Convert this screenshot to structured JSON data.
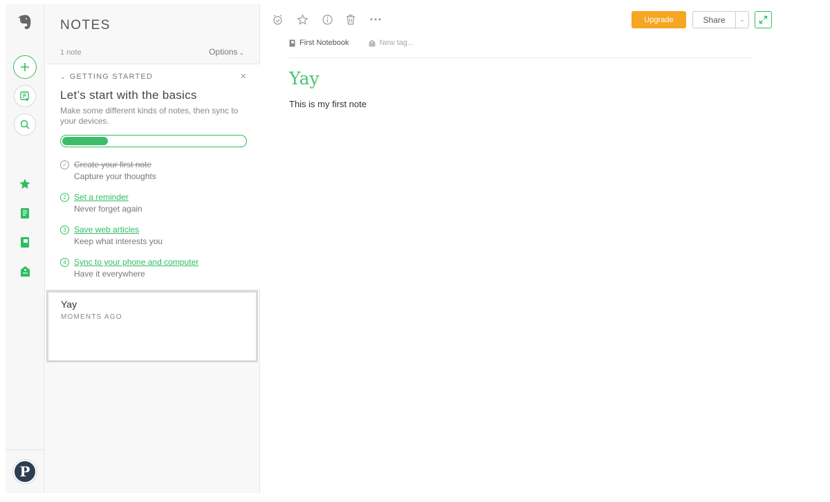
{
  "sidebar_rail": {
    "icons": [
      "elephant-logo",
      "new-note-icon",
      "work-chat-icon",
      "search-icon",
      "shortcuts-star-icon",
      "notes-icon",
      "notebooks-icon",
      "tags-icon"
    ],
    "avatar_letter": "P",
    "accent": "#2dbe60"
  },
  "notes_panel": {
    "title": "NOTES",
    "note_count": "1 note",
    "options_label": "Options"
  },
  "getting_started": {
    "header": "GETTING STARTED",
    "close": "×",
    "title": "Let’s start with the basics",
    "description": "Make some different kinds of notes, then sync to your devices.",
    "progress_fraction": 0.25,
    "steps": [
      {
        "num": "1",
        "label": "Create your first note",
        "sub": "Capture your thoughts",
        "done": true
      },
      {
        "num": "2",
        "label": "Set a reminder",
        "sub": "Never forget again",
        "done": false
      },
      {
        "num": "3",
        "label": "Save web articles",
        "sub": "Keep what interests you",
        "done": false
      },
      {
        "num": "4",
        "label": "Sync to your phone and computer",
        "sub": "Have it everywhere",
        "done": false
      }
    ]
  },
  "note_list": [
    {
      "title": "Yay",
      "date": "MOMENTS AGO"
    }
  ],
  "toolbar": {
    "upgrade_label": "Upgrade",
    "share_label": "Share",
    "upgrade_color": "#f5a623"
  },
  "editor": {
    "notebook": "First Notebook",
    "tag_placeholder": "New tag...",
    "title": "Yay",
    "body": "This is my first note"
  }
}
